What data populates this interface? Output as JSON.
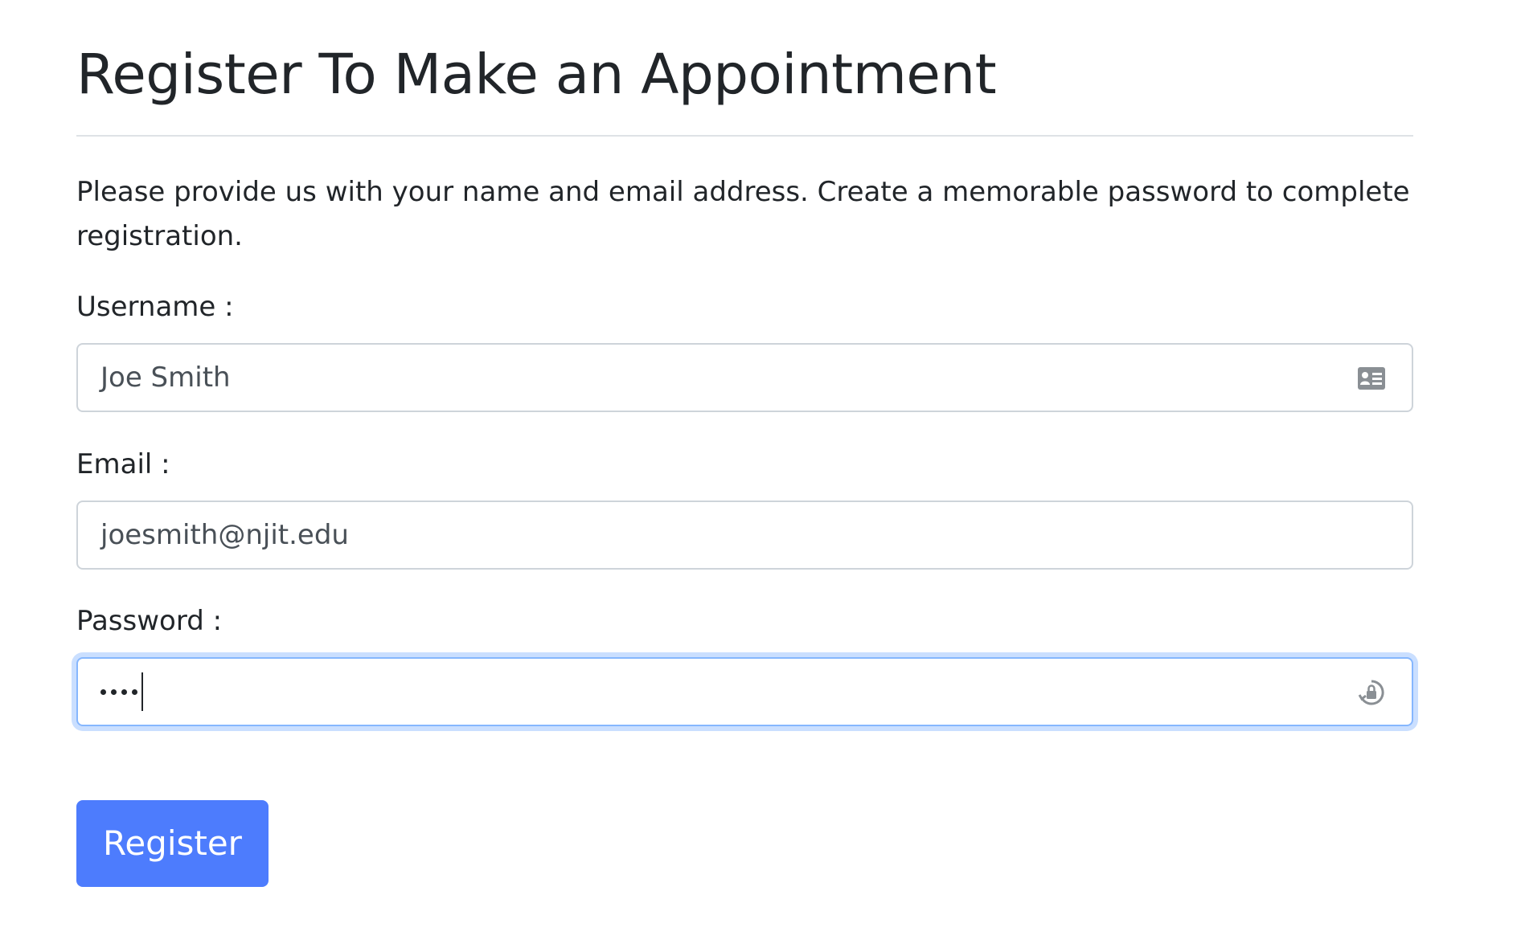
{
  "page": {
    "title": "Register To Make an Appointment",
    "intro": "Please provide us with your name and email address. Create a memorable password to complete registration."
  },
  "form": {
    "username": {
      "label": "Username :",
      "value": "Joe Smith",
      "icon": "contact-card-icon"
    },
    "email": {
      "label": "Email :",
      "value": "joesmith@njit.edu"
    },
    "password": {
      "label": "Password :",
      "masked_length": 4,
      "icon": "password-manager-lock-icon",
      "focused": true
    },
    "submit_label": "Register"
  },
  "colors": {
    "primary_button": "#4d7cfd",
    "focus_ring": "#86b7fe",
    "text": "#212529",
    "input_text": "#495057",
    "border": "#ced4da"
  }
}
